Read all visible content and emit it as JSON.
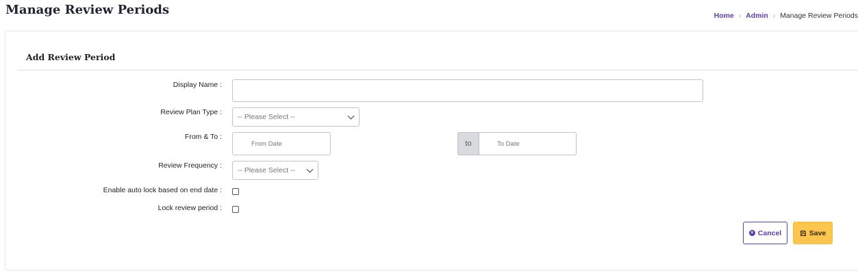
{
  "header": {
    "title": "Manage Review Periods",
    "breadcrumb": [
      "Home",
      "Admin",
      "Manage Review Periods"
    ]
  },
  "form": {
    "title": "Add Review Period",
    "display_name_label": "Display Name :",
    "display_name_value": "",
    "plan_type_label": "Review Plan Type :",
    "plan_type_selected": "-- Please Select --",
    "from_to_label": "From & To :",
    "from_placeholder": "From Date",
    "to_addon": "to",
    "to_placeholder": "To Date",
    "frequency_label": "Review Frequency :",
    "frequency_selected": "-- Please Select --",
    "auto_lock_label": "Enable auto lock based on end date :",
    "auto_lock_checked": false,
    "lock_label": "Lock review period :",
    "lock_checked": false
  },
  "actions": {
    "cancel_label": "Cancel",
    "save_label": "Save"
  },
  "colors": {
    "accent": "#5b3fa6",
    "save": "#fcc64e"
  }
}
